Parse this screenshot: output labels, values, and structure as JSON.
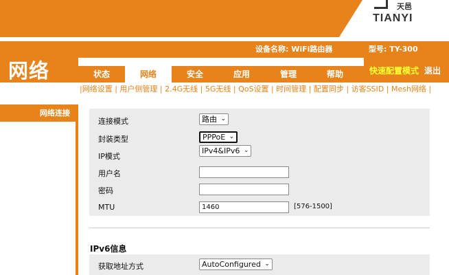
{
  "brand": {
    "cn": "天邑",
    "en": "TIANYI"
  },
  "header": {
    "device_name_label": "设备名称: WiFi路由器",
    "model_label": "型号: TY-300",
    "page_title": "网络",
    "quick_config": "快速配置模式",
    "logout": "退出"
  },
  "tabs": [
    "状态",
    "网络",
    "安全",
    "应用",
    "管理",
    "帮助"
  ],
  "subnav": [
    "网络设置",
    "用户侧管理",
    "2.4G无线",
    "5G无线",
    "QoS设置",
    "时间管理",
    "配置同步",
    "访客SSID",
    "Mesh网络"
  ],
  "sidebar": {
    "items": [
      "网络连接"
    ]
  },
  "form": {
    "connection_mode": {
      "label": "连接模式",
      "value": "路由"
    },
    "encap_type": {
      "label": "封装类型",
      "value": "PPPoE"
    },
    "ip_mode": {
      "label": "IP模式",
      "value": "IPv4&IPv6"
    },
    "username": {
      "label": "用户名",
      "value": ""
    },
    "password": {
      "label": "密码",
      "value": ""
    },
    "mtu": {
      "label": "MTU",
      "value": "1460",
      "hint": "[576-1500]"
    }
  },
  "ipv6": {
    "title": "IPv6信息",
    "addr_method": {
      "label": "获取地址方式",
      "value": "AutoConfigured"
    }
  },
  "colors": {
    "accent": "#e8821a",
    "quick_link": "#ffff33",
    "form_bg": "#ebebeb"
  },
  "icons": {
    "dropdown": "chevron-down-icon"
  }
}
